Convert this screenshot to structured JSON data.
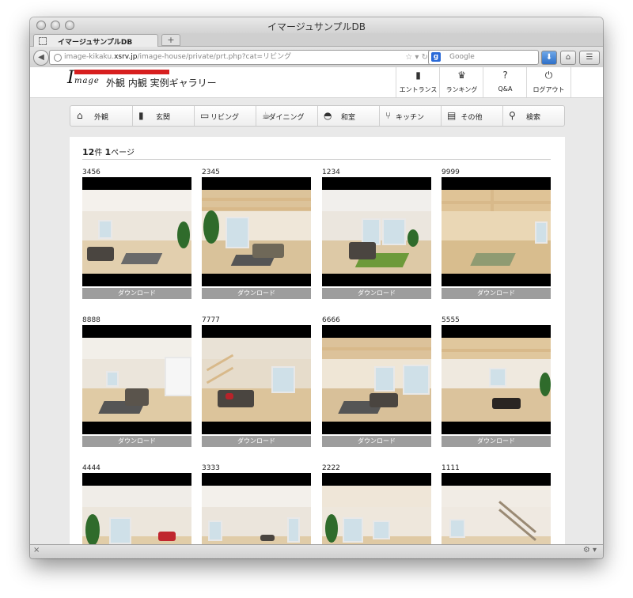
{
  "window": {
    "title": "イマージュサンプルDB"
  },
  "tab": {
    "label": "イマージュサンプルDB",
    "new_tab": "+"
  },
  "nav": {
    "url_prefix": "image-kikaku.",
    "url_domain": "xsrv.jp",
    "url_path": "/image-house/private/prt.php?cat=リビング",
    "search_placeholder": "Google"
  },
  "site": {
    "title": "外観 内観 実例ギャラリー",
    "logo_letter": "I",
    "logo_text": "mage",
    "util": [
      {
        "label": "エントランス",
        "icon": "door-icon"
      },
      {
        "label": "ランキング",
        "icon": "trophy-icon"
      },
      {
        "label": "Q&A",
        "icon": "question-icon"
      },
      {
        "label": "ログアウト",
        "icon": "power-icon"
      }
    ],
    "menu": [
      {
        "label": "外観",
        "icon": "house-icon"
      },
      {
        "label": "玄関",
        "icon": "door-icon"
      },
      {
        "label": "リビング",
        "icon": "monitor-icon"
      },
      {
        "label": "ダイニング",
        "icon": "cup-icon"
      },
      {
        "label": "和室",
        "icon": "fan-icon"
      },
      {
        "label": "キッチン",
        "icon": "utensils-icon"
      },
      {
        "label": "その他",
        "icon": "chat-icon"
      },
      {
        "label": "検索",
        "icon": "search-icon"
      }
    ]
  },
  "gallery": {
    "count": "12",
    "count_unit": "件",
    "pages": "1",
    "pages_unit": "ページ",
    "download_label": "ダウンロード",
    "items": [
      {
        "id": "3456"
      },
      {
        "id": "2345"
      },
      {
        "id": "1234"
      },
      {
        "id": "9999"
      },
      {
        "id": "8888"
      },
      {
        "id": "7777"
      },
      {
        "id": "6666"
      },
      {
        "id": "5555"
      },
      {
        "id": "4444"
      },
      {
        "id": "3333"
      },
      {
        "id": "2222"
      },
      {
        "id": "1111"
      }
    ]
  }
}
